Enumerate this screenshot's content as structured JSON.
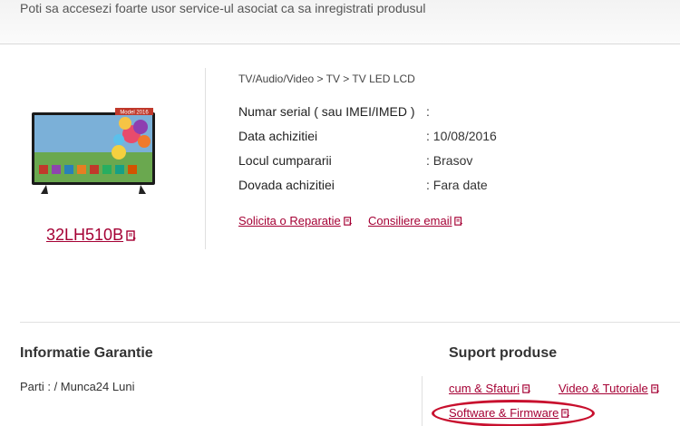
{
  "banner": {
    "text": "Poti sa accesezi foarte usor service-ul asociat ca sa inregistrati produsul"
  },
  "product": {
    "image_badge": "Model 2016",
    "model": "32LH510B",
    "breadcrumb": "TV/Audio/Video > TV > TV LED LCD",
    "details": [
      {
        "label": "Numar serial ( sau IMEI/IMED )",
        "value": ":"
      },
      {
        "label": "Data achizitiei",
        "value": ": 10/08/2016"
      },
      {
        "label": "Locul cumpararii",
        "value": ": Brasov"
      },
      {
        "label": "Dovada achizitiei",
        "value": ": Fara date"
      }
    ],
    "actions": {
      "repair": "Solicita o Reparatie",
      "email": "Consiliere email"
    }
  },
  "warranty": {
    "title": "Informatie Garantie",
    "text": "Parti : / Munca24 Luni"
  },
  "support": {
    "title": "Suport produse",
    "links": {
      "tips": "cum & Sfaturi",
      "video": "Video & Tutoriale",
      "software": "Software & Firmware"
    }
  },
  "colors": {
    "accent": "#a50034",
    "highlight": "#c8102e"
  },
  "icons": {
    "external_link": "external-link-icon"
  }
}
